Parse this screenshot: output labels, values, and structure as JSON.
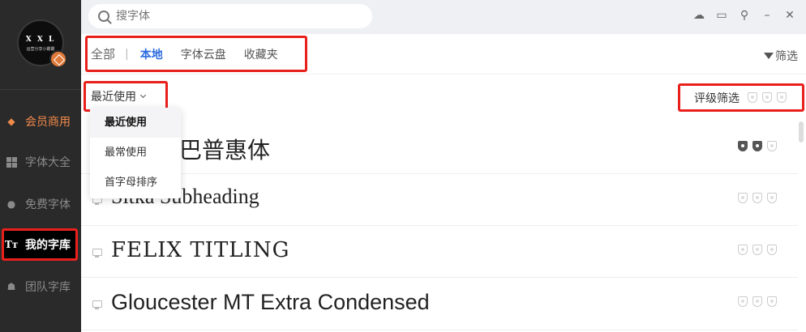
{
  "sidebar": {
    "avatar_text": "X X L",
    "avatar_sub": "运营分享小霸霸",
    "items": [
      {
        "label": "会员商用",
        "icon": "diamond-icon"
      },
      {
        "label": "字体大全",
        "icon": "grid-icon"
      },
      {
        "label": "免费字体",
        "icon": "free-badge-icon"
      },
      {
        "label": "我的字库",
        "icon": "tt-font-icon"
      },
      {
        "label": "团队字库",
        "icon": "team-icon"
      }
    ]
  },
  "search": {
    "placeholder": "搜字体"
  },
  "tabs": {
    "items": [
      {
        "label": "全部"
      },
      {
        "label": "本地"
      },
      {
        "label": "字体云盘"
      },
      {
        "label": "收藏夹"
      }
    ],
    "separator": "|",
    "filter_label": "筛选"
  },
  "sort": {
    "selected": "最近使用",
    "options": [
      "最近使用",
      "最常使用",
      "首字母排序"
    ]
  },
  "rating_filter": {
    "label": "评级筛选"
  },
  "fonts": [
    {
      "name": "阿里巴巴普惠体",
      "rating": 2
    },
    {
      "name": "Sitka Subheading",
      "rating": 0
    },
    {
      "name": "FELIX TITLING",
      "rating": 0
    },
    {
      "name": "Gloucester MT Extra Condensed",
      "rating": 0
    }
  ],
  "colors": {
    "accent": "#2d6cdf",
    "vip": "#f08a4b",
    "highlight": "#e8201c",
    "sidebar_bg": "#2a2a2a"
  }
}
